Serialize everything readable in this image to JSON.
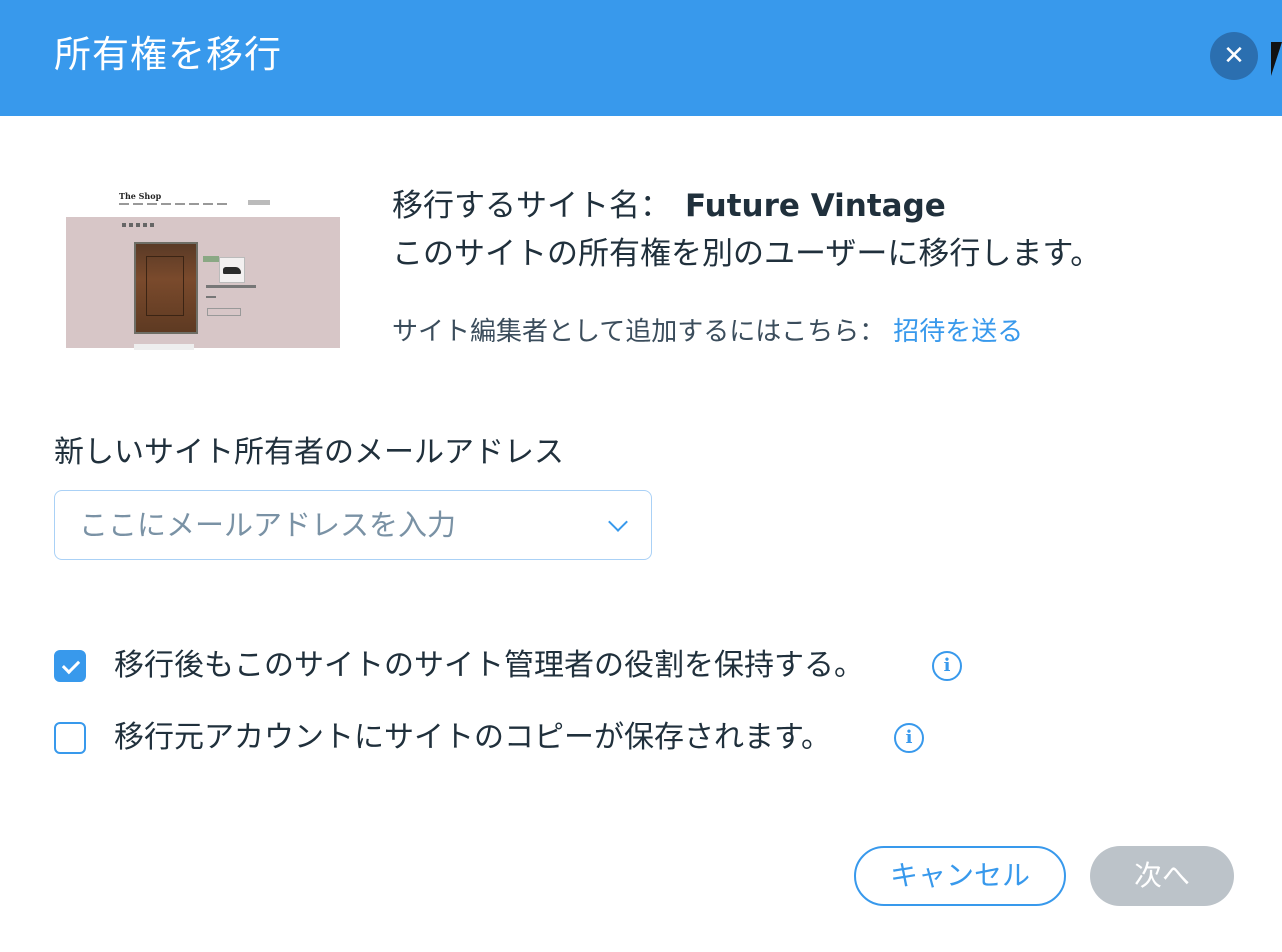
{
  "dialog": {
    "title": "所有権を移行",
    "close_icon": "close-icon"
  },
  "preview": {
    "shop_title": "The Shop"
  },
  "site_info": {
    "site_label": "移行するサイト名：",
    "site_name": "Future Vintage",
    "description": "このサイトの所有権を別のユーザーに移行します。",
    "invite_prefix": "サイト編集者として追加するにはこちら：",
    "invite_link": "招待を送る"
  },
  "email": {
    "label": "新しいサイト所有者のメールアドレス",
    "placeholder": "ここにメールアドレスを入力",
    "value": ""
  },
  "options": [
    {
      "label": "移行後もこのサイトのサイト管理者の役割を保持する。",
      "checked": true,
      "icon": "info-icon"
    },
    {
      "label": "移行元アカウントにサイトのコピーが保存されます。",
      "checked": false,
      "icon": "info-icon"
    }
  ],
  "actions": {
    "cancel": "キャンセル",
    "next": "次へ",
    "next_enabled": false
  },
  "colors": {
    "accent": "#3899ec",
    "header": "#3899ec",
    "disabled_button": "#bcc3c9",
    "text": "#20303c"
  }
}
